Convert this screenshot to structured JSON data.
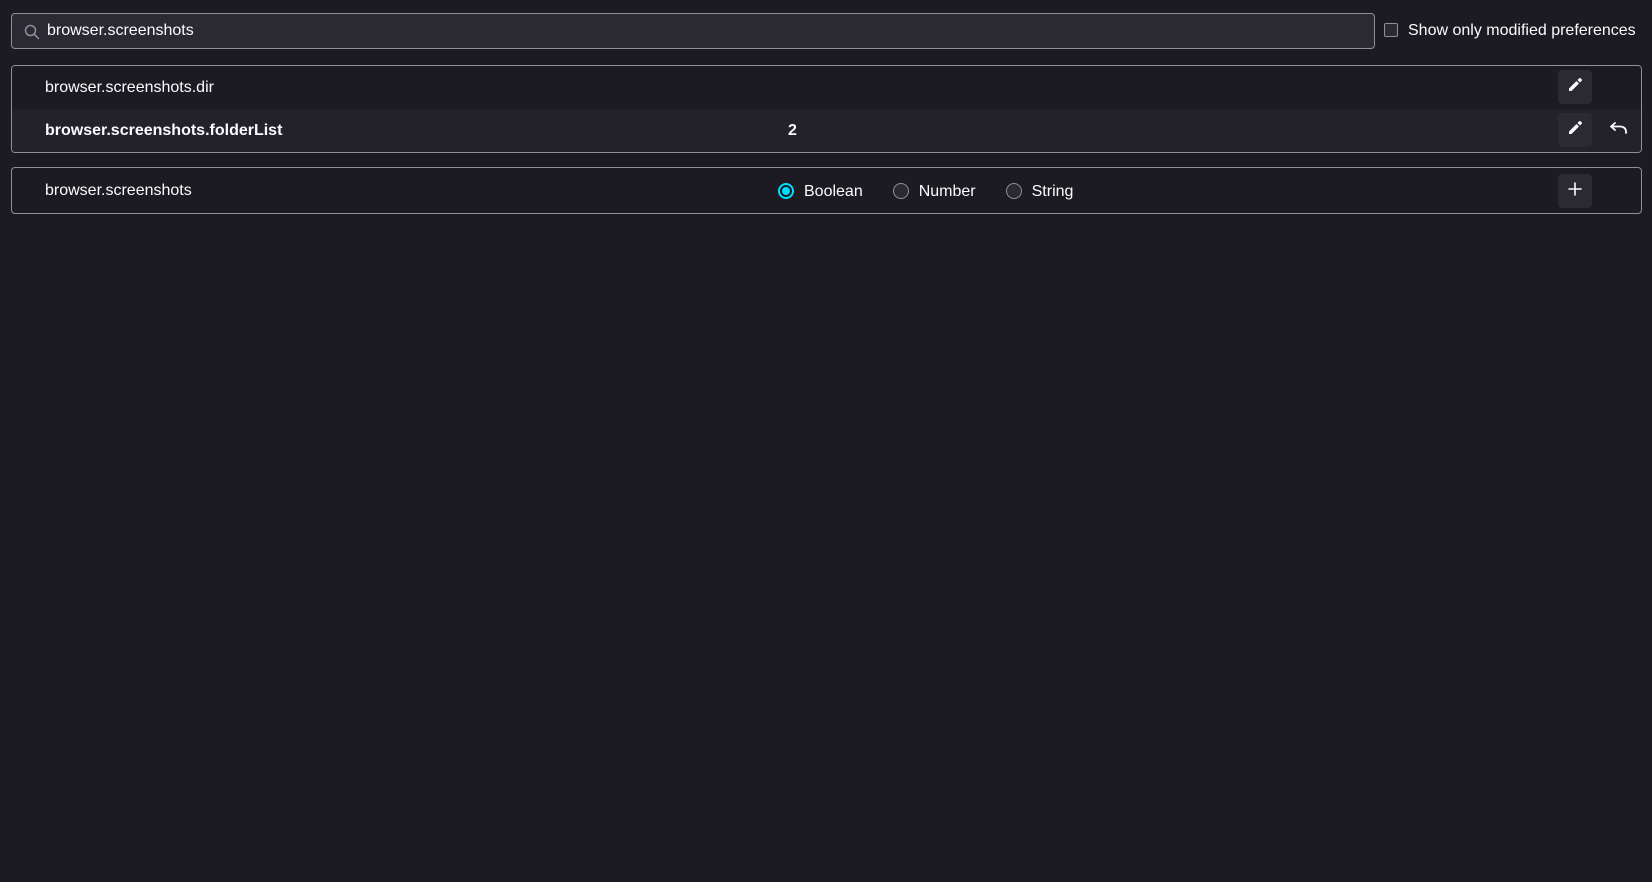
{
  "search": {
    "value": "browser.screenshots",
    "icon": "search-icon"
  },
  "filter": {
    "show_modified_label": "Show only modified preferences",
    "checked": false
  },
  "preferences": [
    {
      "name": "browser.screenshots.dir",
      "value": "",
      "modified": false,
      "actions": [
        "edit-icon"
      ]
    },
    {
      "name": "browser.screenshots.folderList",
      "value": "2",
      "modified": true,
      "actions": [
        "edit-icon",
        "reset-icon"
      ]
    }
  ],
  "new_pref": {
    "name": "browser.screenshots",
    "types": [
      {
        "label": "Boolean",
        "selected": true
      },
      {
        "label": "Number",
        "selected": false
      },
      {
        "label": "String",
        "selected": false
      }
    ],
    "add_icon": "plus-icon"
  },
  "colors": {
    "background": "#1c1b22",
    "alt_row": "#23222b",
    "accent": "#00ddff",
    "border": "#8f8f9d",
    "text": "#fbfbfe"
  }
}
